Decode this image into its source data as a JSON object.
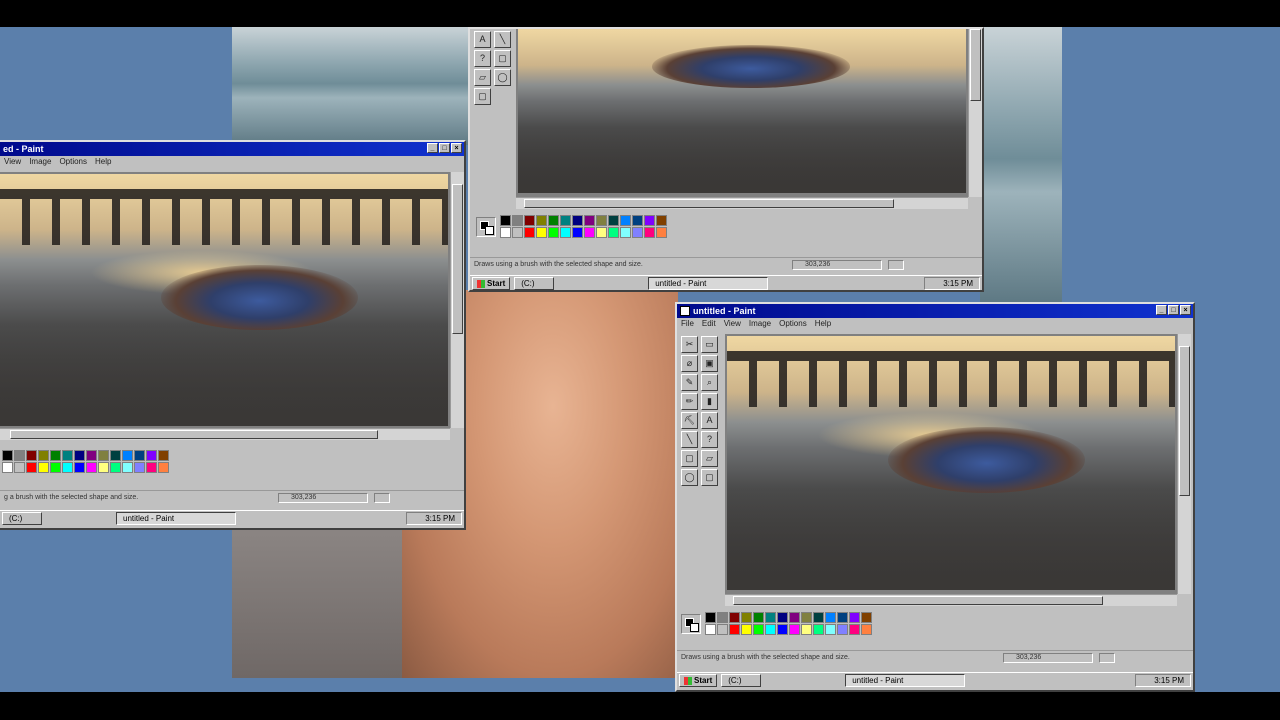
{
  "windows": {
    "left": {
      "title": "ed - Paint",
      "menu": [
        "View",
        "Image",
        "Options",
        "Help"
      ],
      "status_text": "g a brush with the selected shape and size.",
      "coords": "303,236",
      "taskbar": {
        "item1": "(C:)",
        "item2": "untitled - Paint",
        "clock": "3:15 PM"
      }
    },
    "top": {
      "status_text": "Draws using a brush with the selected shape and size.",
      "coords": "303,236",
      "taskbar": {
        "start": "Start",
        "item1": "(C:)",
        "item2": "untitled - Paint",
        "clock": "3:15 PM"
      }
    },
    "right": {
      "title": "untitled - Paint",
      "menu": [
        "File",
        "Edit",
        "View",
        "Image",
        "Options",
        "Help"
      ],
      "status_text": "Draws using a brush with the selected shape and size.",
      "coords": "303,236",
      "taskbar": {
        "start": "Start",
        "item1": "(C:)",
        "item2": "untitled - Paint",
        "clock": "3:15 PM"
      }
    }
  },
  "title_buttons": {
    "minimize": "_",
    "maximize": "□",
    "close": "×"
  },
  "tool_glyphs": [
    "✂",
    "▭",
    "⌀",
    "▣",
    "✎",
    "⌕",
    "✏",
    "▮",
    "⛏",
    "A",
    "╲",
    "?",
    "▢",
    "▱",
    "◯",
    "▢"
  ],
  "palette_colors": [
    "#000000",
    "#ffffff",
    "#808080",
    "#c0c0c0",
    "#800000",
    "#ff0000",
    "#808000",
    "#ffff00",
    "#008000",
    "#00ff00",
    "#008080",
    "#00ffff",
    "#000080",
    "#0000ff",
    "#800080",
    "#ff00ff",
    "#808040",
    "#ffff80",
    "#004040",
    "#00ff80",
    "#0080ff",
    "#80ffff",
    "#004080",
    "#8080ff",
    "#8000ff",
    "#ff0080",
    "#804000",
    "#ff8040"
  ]
}
